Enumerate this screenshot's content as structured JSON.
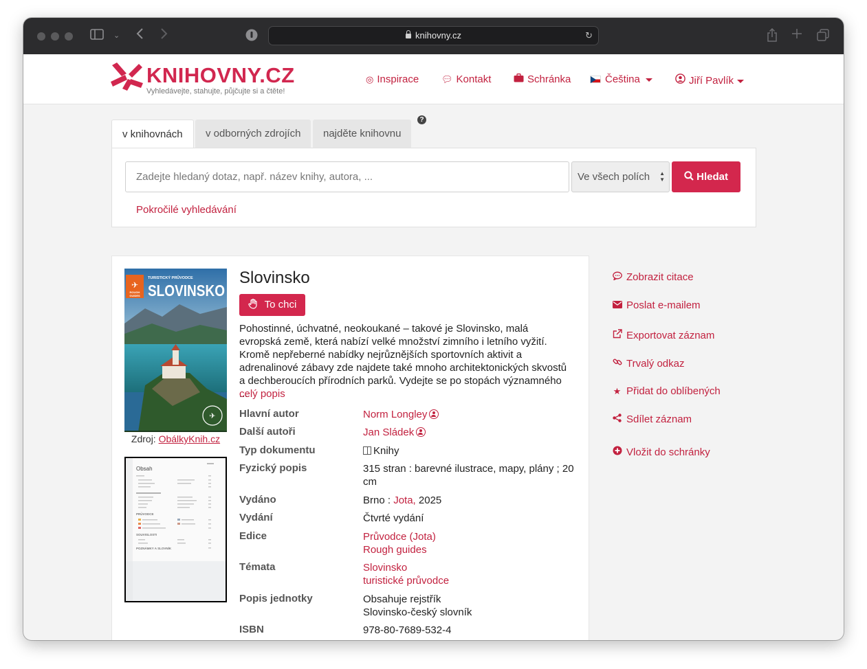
{
  "browser": {
    "url": "knihovny.cz"
  },
  "header": {
    "logo_text": "KNIHOVNY.CZ",
    "tagline": "Vyhledávejte, stahujte, půjčujte si a čtěte!",
    "nav": {
      "inspirace": "Inspirace",
      "kontakt": "Kontakt",
      "schranka": "Schránka",
      "language": "Čeština",
      "user": "Jiří Pavlík"
    }
  },
  "search": {
    "tabs": [
      "v knihovnách",
      "v odborných zdrojích",
      "najděte knihovnu"
    ],
    "help": "?",
    "placeholder": "Zadejte hledaný dotaz, např. název knihy, autora, ...",
    "field_select": "Ve všech polích",
    "button": "Hledat",
    "advanced": "Pokročilé vyhledávání"
  },
  "record": {
    "title": "Slovinsko",
    "want_button": "To chci",
    "description": "Pohostinné, úchvatné, neokoukané – takové je Slovinsko, malá evropská země, která nabízí velké množství zimního i letního vyžití. Kromě nepřeberné nabídky nejrůznějších sportovních aktivit a adrenalinové zábavy zde najdete také mnoho architektonických skvostů a dechberoucích přírodních parků. Vydejte se po stopách významného ...",
    "more_link": "celý popis",
    "cover": {
      "series_small": "TURISTICKÝ PRŮVODCE",
      "title": "SLOVINSKO",
      "badge_top": "ROUGH",
      "badge_bottom": "GUIDES",
      "source_label": "Zdroj:",
      "source_link": "ObálkyKnih.cz"
    },
    "toc": {
      "heading": "Obsah",
      "sections": [
        "PRŮVODCE",
        "SOUVISLOSTI",
        "POZNÁMKY A SLOVNÍK"
      ]
    },
    "fields": {
      "hlavni_autor_label": "Hlavní autor",
      "hlavni_autor": "Norm Longley",
      "dalsi_autori_label": "Další autoři",
      "dalsi_autori": "Jan Sládek",
      "typ_label": "Typ dokumentu",
      "typ": "Knihy",
      "fyzicky_label": "Fyzický popis",
      "fyzicky": "315 stran : barevné ilustrace, mapy, plány ; 20 cm",
      "vydano_label": "Vydáno",
      "vydano_place": "Brno :",
      "vydano_publisher": "Jota,",
      "vydano_year": "2025",
      "vydani_label": "Vydání",
      "vydani": "Čtvrté vydání",
      "edice_label": "Edice",
      "edice": [
        "Průvodce (Jota)",
        "Rough guides"
      ],
      "temata_label": "Témata",
      "temata": [
        "Slovinsko",
        "turistické průvodce"
      ],
      "popis_label": "Popis jednotky",
      "popis": [
        "Obsahuje rejstřík",
        "Slovinsko-český slovník"
      ],
      "isbn_label": "ISBN",
      "isbn": "978-80-7689-532-4"
    }
  },
  "actions": [
    "Zobrazit citace",
    "Poslat e-mailem",
    "Exportovat záznam",
    "Trvalý odkaz",
    "Přidat do oblíbených",
    "Sdílet záznam",
    "Vložit do schránky"
  ],
  "colors": {
    "brand": "#d3274d",
    "link": "#c2213f"
  }
}
